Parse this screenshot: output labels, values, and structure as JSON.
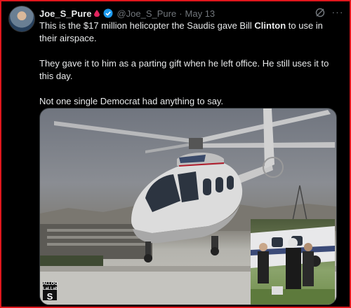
{
  "post": {
    "display_name": "Joe_S_Pure",
    "handle": "@Joe_S_Pure",
    "separator": "·",
    "date": "May 13",
    "more_label": "···",
    "text_line1_before": "This is the $17 million helicopter the Saudis gave Bill ",
    "text_line1_bold": "Clinton",
    "text_line1_after": " to use in their airspace.",
    "text_para2": "They gave it to him as a parting gift when he left office. He still uses it to this day.",
    "text_para3": "Not one single Democrat had anything to say."
  },
  "media": {
    "watermark_top": "ALLOO",
    "watermark_mid": "LaLLab",
    "watermark_logo": "S"
  },
  "colors": {
    "background": "#000000",
    "border_red": "#e0161c",
    "verified_blue": "#1d9bf0",
    "secondary_text": "#71767b",
    "drop_red": "#e0245e"
  },
  "icons": [
    "drop-icon",
    "verified-badge-icon",
    "grok-icon",
    "more-icon"
  ]
}
